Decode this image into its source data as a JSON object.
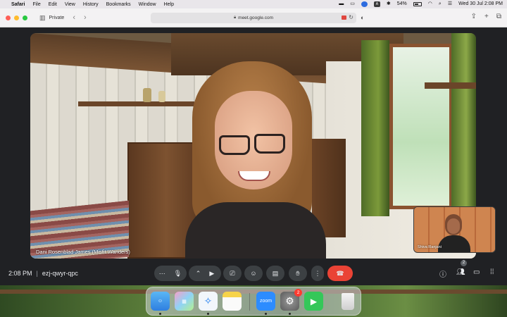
{
  "menubar": {
    "app_name": "Safari",
    "items": [
      "File",
      "Edit",
      "View",
      "History",
      "Bookmarks",
      "Window",
      "Help"
    ],
    "battery": "54%",
    "datetime": "Wed 30 Jul  2:08 PM",
    "status_badge": "A"
  },
  "safari": {
    "private_label": "Private",
    "url": "meet.google.com"
  },
  "meet": {
    "main_participant": "Dani Rosenblad James (Misfit Wanders)",
    "self_participant": "Shiva Ranjani",
    "time": "2:08 PM",
    "separator": "|",
    "meeting_code": "ezj-qwyr-qpc",
    "people_count": "2"
  },
  "dock": {
    "zoom_label": "zoom",
    "settings_badge": "2"
  },
  "colors": {
    "end_call": "#ea4335",
    "meet_bg": "#202124"
  }
}
